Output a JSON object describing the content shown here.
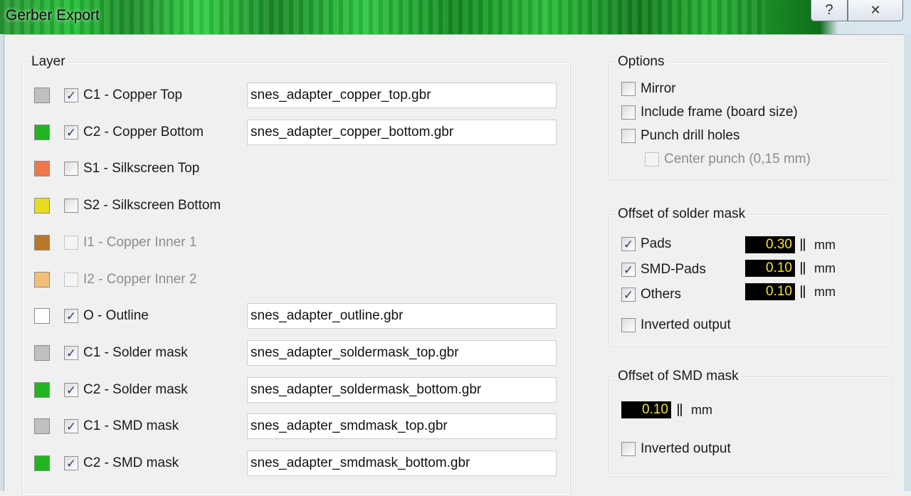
{
  "window": {
    "title": "Gerber Export",
    "help_glyph": "?",
    "close_glyph": "✕"
  },
  "layer_group": {
    "legend": "Layer",
    "rows": [
      {
        "swatch_color": "#c0c0c0",
        "checked": true,
        "enabled": true,
        "label": "C1 - Copper Top",
        "filename": "snes_adapter_copper_top.gbr"
      },
      {
        "swatch_color": "#1eb51e",
        "checked": true,
        "enabled": true,
        "label": "C2 - Copper Bottom",
        "filename": "snes_adapter_copper_bottom.gbr"
      },
      {
        "swatch_color": "#f07848",
        "checked": false,
        "enabled": true,
        "label": "S1 - Silkscreen Top",
        "filename": null
      },
      {
        "swatch_color": "#e8dc1e",
        "checked": false,
        "enabled": true,
        "label": "S2 - Silkscreen Bottom",
        "filename": null
      },
      {
        "swatch_color": "#b8782a",
        "checked": false,
        "enabled": false,
        "label": "I1 - Copper Inner 1",
        "filename": null
      },
      {
        "swatch_color": "#f0c078",
        "checked": false,
        "enabled": false,
        "label": "I2 - Copper Inner 2",
        "filename": null
      },
      {
        "swatch_color": "#ffffff",
        "checked": true,
        "enabled": true,
        "label": "O - Outline",
        "filename": "snes_adapter_outline.gbr"
      },
      {
        "swatch_color": "#c0c0c0",
        "checked": true,
        "enabled": true,
        "label": "C1 - Solder mask",
        "filename": "snes_adapter_soldermask_top.gbr"
      },
      {
        "swatch_color": "#1eb51e",
        "checked": true,
        "enabled": true,
        "label": "C2 - Solder mask",
        "filename": "snes_adapter_soldermask_bottom.gbr"
      },
      {
        "swatch_color": "#c0c0c0",
        "checked": true,
        "enabled": true,
        "label": "C1 - SMD mask",
        "filename": "snes_adapter_smdmask_top.gbr"
      },
      {
        "swatch_color": "#1eb51e",
        "checked": true,
        "enabled": true,
        "label": "C2 - SMD mask",
        "filename": "snes_adapter_smdmask_bottom.gbr"
      }
    ]
  },
  "options_group": {
    "legend": "Options",
    "mirror": {
      "label": "Mirror",
      "checked": false
    },
    "include_frame": {
      "label": "Include frame (board size)",
      "checked": false
    },
    "punch_drill_holes": {
      "label": "Punch drill holes",
      "checked": false
    },
    "center_punch": {
      "label": "Center punch (0,15 mm)",
      "checked": false,
      "enabled": false
    }
  },
  "solder_mask_group": {
    "legend": "Offset of solder mask",
    "pads": {
      "label": "Pads",
      "checked": true,
      "value": "0.30",
      "unit": "mm"
    },
    "smd_pads": {
      "label": "SMD-Pads",
      "checked": true,
      "value": "0.10",
      "unit": "mm"
    },
    "others": {
      "label": "Others",
      "checked": true,
      "value": "0.10",
      "unit": "mm"
    },
    "inverted": {
      "label": "Inverted output",
      "checked": false
    }
  },
  "smd_mask_group": {
    "legend": "Offset of SMD mask",
    "offset": {
      "value": "0.10",
      "unit": "mm"
    },
    "inverted": {
      "label": "Inverted output",
      "checked": false
    }
  },
  "checkmark_glyph": "✓"
}
